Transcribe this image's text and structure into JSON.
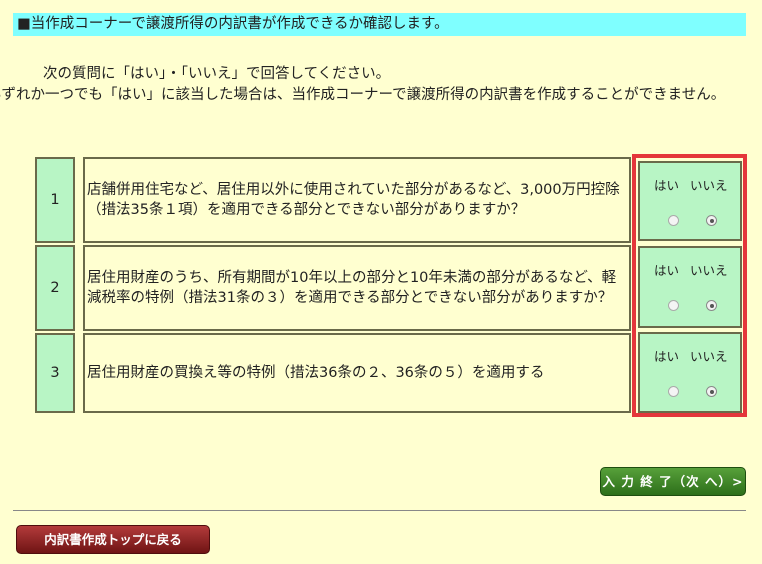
{
  "banner": "■当作成コーナーで譲渡所得の内訳書が作成できるか確認します。",
  "intro": {
    "line1": "次の質問に「はい」・「いいえ」で回答してください。",
    "line2": "いずれか一つでも「はい」に該当した場合は、当作成コーナーで譲渡所得の内訳書を作成することができません。"
  },
  "questions": [
    {
      "num": "1",
      "text": "店舗併用住宅など、居住用以外に使用されていた部分があるなど、3,000万円控除（措法35条１項）を適用できる部分とできない部分がありますか？",
      "yes_label": "はい",
      "no_label": "いいえ",
      "selected": "いいえ"
    },
    {
      "num": "2",
      "text": "居住用財産のうち、所有期間が10年以上の部分と10年未満の部分があるなど、軽減税率の特例（措法31条の３）を適用できる部分とできない部分がありますか？",
      "yes_label": "はい",
      "no_label": "いいえ",
      "selected": "いいえ"
    },
    {
      "num": "3",
      "text": "居住用財産の買換え等の特例（措法36条の２、36条の５）を適用する",
      "yes_label": "はい",
      "no_label": "いいえ",
      "selected": "いいえ"
    }
  ],
  "buttons": {
    "next": "入 力 終 了（次 へ）>",
    "back": "内訳書作成トップに戻る"
  },
  "colors": {
    "highlight": "#e4363b",
    "next_button": "#3f8a2a",
    "back_button": "#8f2020"
  }
}
